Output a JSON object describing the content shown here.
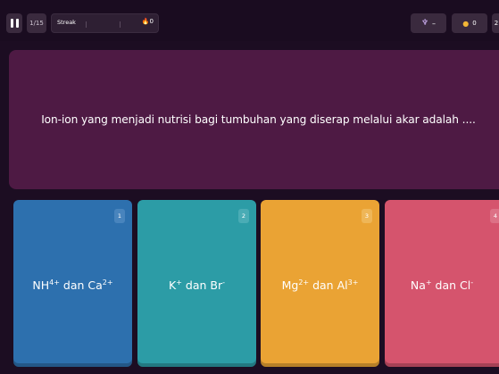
{
  "topbar": {
    "question_counter": "1/15",
    "streak_label": "Streak",
    "streak_count": "0",
    "powerup_value": "–",
    "coins_value": "0",
    "extra_label": "2"
  },
  "question": {
    "text": "Ion-ion yang menjadi nutrisi bagi tumbuhan yang diserap melalui akar adalah ...."
  },
  "answers": [
    {
      "number": "1",
      "base1": "NH",
      "sup1": "4+",
      "mid": " dan Ca",
      "sup2": "2+",
      "color": "#2d70ae"
    },
    {
      "number": "2",
      "base1": "K",
      "sup1": "+",
      "mid": " dan Br",
      "sup2": "-",
      "color": "#2c9ca6"
    },
    {
      "number": "3",
      "base1": "Mg",
      "sup1": "2+",
      "mid": " dan Al",
      "sup2": "3+",
      "color": "#eaa334"
    },
    {
      "number": "4",
      "base1": "Na",
      "sup1": "+",
      "mid": " dan Cl",
      "sup2": "-",
      "color": "#d5546d"
    }
  ],
  "colors": {
    "background": "#1c0d22",
    "question_panel": "#4e1a44"
  },
  "icons": {
    "pause": "pause-icon",
    "streak": "fire-icon",
    "powerup": "powerup-icon",
    "coins": "coin-icon"
  }
}
